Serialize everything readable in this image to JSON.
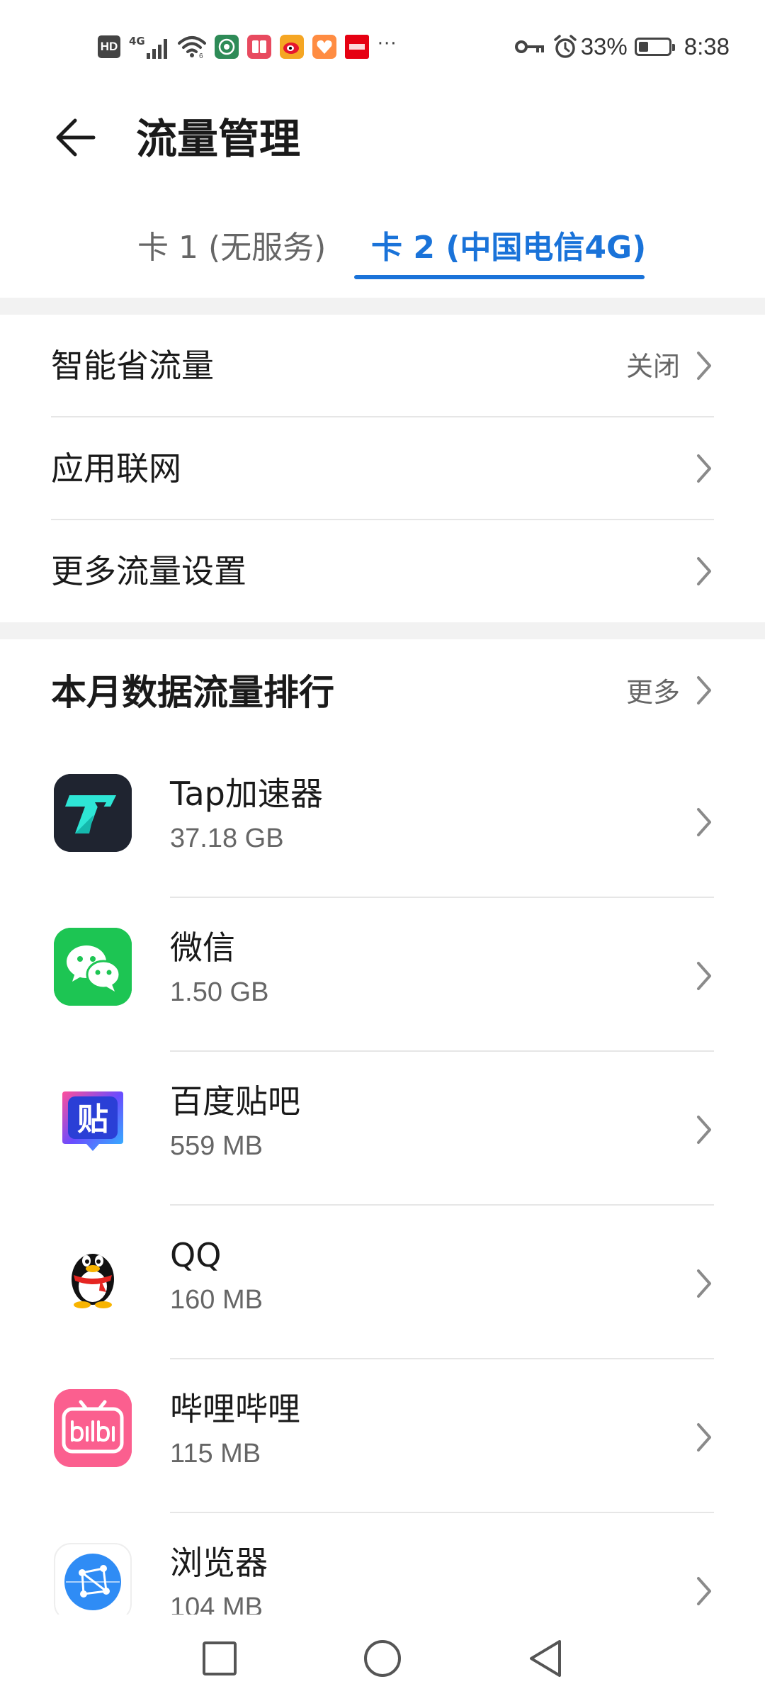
{
  "status_bar": {
    "hd_label": "HD",
    "network_type": "4G",
    "notification_icons": [
      "app-icon-1",
      "app-icon-2",
      "weibo-icon",
      "app-icon-4",
      "app-icon-5"
    ],
    "more_indicator": "···",
    "battery_percent": "33%",
    "battery_level": 0.33,
    "time": "8:38"
  },
  "header": {
    "title": "流量管理"
  },
  "tabs": [
    {
      "label": "卡 1 (无服务)",
      "active": false
    },
    {
      "label": "卡 2 (中国电信4G)",
      "active": true
    }
  ],
  "settings": [
    {
      "label": "智能省流量",
      "value": "关闭"
    },
    {
      "label": "应用联网",
      "value": ""
    },
    {
      "label": "更多流量设置",
      "value": ""
    }
  ],
  "ranking": {
    "title": "本月数据流量排行",
    "more_label": "更多",
    "apps": [
      {
        "name": "Tap加速器",
        "usage": "37.18 GB",
        "icon": "tap-accelerator-icon"
      },
      {
        "name": "微信",
        "usage": "1.50 GB",
        "icon": "wechat-icon"
      },
      {
        "name": "百度贴吧",
        "usage": "559 MB",
        "icon": "baidu-tieba-icon"
      },
      {
        "name": "QQ",
        "usage": "160 MB",
        "icon": "qq-penguin-icon"
      },
      {
        "name": "哔哩哔哩",
        "usage": "115 MB",
        "icon": "bilibili-icon"
      },
      {
        "name": "浏览器",
        "usage": "104 MB",
        "icon": "browser-icon"
      }
    ]
  },
  "tieba_glyph": "贴",
  "colors": {
    "accent": "#1a73d9",
    "text_primary": "#1a1a1a",
    "text_secondary": "#666666",
    "divider": "#e6e6e6",
    "section_bg": "#f2f2f2"
  }
}
